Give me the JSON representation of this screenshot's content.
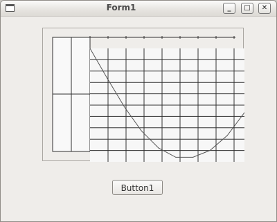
{
  "window": {
    "title": "Form1",
    "minimize_glyph": "_",
    "maximize_glyph": "□",
    "close_glyph": "✕"
  },
  "button1": {
    "label": "Button1"
  },
  "chart_data": {
    "type": "line",
    "title": "",
    "xlabel": "",
    "ylabel": "",
    "grid": true,
    "x": [
      0,
      1,
      2,
      3,
      4,
      5,
      6,
      7,
      8,
      9
    ],
    "series": [
      {
        "values": [
          0,
          2.6,
          5.1,
          7.2,
          8.7,
          9.5,
          9.5,
          8.9,
          7.6,
          5.6
        ]
      }
    ]
  },
  "colors": {
    "grid": "#303030",
    "curve": "#555555",
    "plot_bg": "#f7f7f7"
  }
}
